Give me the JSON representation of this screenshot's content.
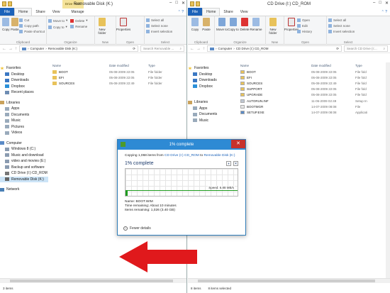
{
  "left": {
    "title": "Removable Disk (K:)",
    "context_tab": "Drive Tools",
    "tabs": [
      "File",
      "Home",
      "Share",
      "View",
      "Manage"
    ],
    "ribbon": {
      "clipboard": {
        "label": "Clipboard",
        "copy": "Copy",
        "paste": "Paste",
        "cut": "Cut",
        "copy_path": "Copy path",
        "paste_shortcut": "Paste shortcut"
      },
      "organize": {
        "label": "Organize",
        "move_to": "Move to",
        "copy_to": "Copy to",
        "delete": "Delete",
        "rename": "Rename"
      },
      "new": {
        "label": "New",
        "new_folder": "New folder"
      },
      "open": {
        "label": "Open",
        "properties": "Properties"
      },
      "select": {
        "label": "Select",
        "select_all": "Select all",
        "select_none": "Select none",
        "invert": "Invert selection"
      }
    },
    "address": [
      "Computer",
      "Removable Disk (K:)"
    ],
    "search_placeholder": "Search Removable ...",
    "columns": [
      "Name",
      "Date modified",
      "Type"
    ],
    "files": [
      {
        "name": "BOOT",
        "date": "05-08-2009 22:05",
        "type": "File folder"
      },
      {
        "name": "EFI",
        "date": "05-08-2009 22:05",
        "type": "File folder"
      },
      {
        "name": "SOURCES",
        "date": "05-08-2009 22:49",
        "type": "File folder"
      }
    ],
    "nav": {
      "favorites": "Favorites",
      "fav_items": [
        "Desktop",
        "Downloads",
        "Dropbox",
        "Recent places"
      ],
      "libraries": "Libraries",
      "lib_items": [
        "Apps",
        "Documents",
        "Music",
        "Pictures",
        "Videos"
      ],
      "computer": "Computer",
      "comp_items": [
        "Windows 8 (C:)",
        "Music and download",
        "video and movies (E:)",
        "Backup and software",
        "CD Drive (I:) CD_ROM",
        "Removable Disk (K:)"
      ],
      "network": "Network"
    },
    "status": "3 items"
  },
  "right": {
    "title": "CD Drive (I:) CD_ROM",
    "tabs": [
      "File",
      "Home",
      "Share",
      "View"
    ],
    "ribbon": {
      "clipboard": {
        "label": "Clipboard",
        "copy": "Copy",
        "paste": "Paste"
      },
      "organize": {
        "label": "Organize",
        "move_to": "Move to",
        "copy_to": "Copy to",
        "delete": "Delete",
        "rename": "Rename"
      },
      "new": {
        "label": "New",
        "new_folder": "New folder"
      },
      "open": {
        "label": "Open",
        "properties": "Properties",
        "open": "Open",
        "edit": "Edit",
        "history": "History"
      },
      "select": {
        "label": "Select",
        "select_all": "Select all",
        "select_none": "Select none",
        "invert": "Invert selection"
      }
    },
    "address": [
      "Computer",
      "CD Drive (I:) CD_ROM"
    ],
    "search_placeholder": "Search CD Drive (I:...",
    "columns": [
      "Name",
      "Date modified",
      "Type"
    ],
    "files": [
      {
        "name": "BOOT",
        "date": "05-08-2009 22:05",
        "type": "File fold",
        "kind": "folder"
      },
      {
        "name": "EFI",
        "date": "05-08-2009 22:05",
        "type": "File fold",
        "kind": "folder"
      },
      {
        "name": "SOURCES",
        "date": "05-08-2009 22:49",
        "type": "File fold",
        "kind": "folder"
      },
      {
        "name": "SUPPORT",
        "date": "05-08-2009 22:05",
        "type": "File fold",
        "kind": "folder"
      },
      {
        "name": "UPGRADE",
        "date": "05-08-2009 22:05",
        "type": "File fold",
        "kind": "folder"
      },
      {
        "name": "AUTORUN.INF",
        "date": "11-06-2009 02:49",
        "type": "Setup In",
        "kind": "setup"
      },
      {
        "name": "BOOTMGR",
        "date": "14-07-2009 08:08",
        "type": "File",
        "kind": "file"
      },
      {
        "name": "SETUP.EXE",
        "date": "14-07-2009 08:08",
        "type": "Applicati",
        "kind": "exe"
      }
    ],
    "nav": {
      "favorites": "Favorites",
      "fav_items": [
        "Desktop",
        "Downloads",
        "Dropbox"
      ],
      "libraries": "Libraries",
      "lib_items": [
        "Apps",
        "Documents",
        "Music"
      ]
    },
    "status": "8 items",
    "status_selected": "8 items selected"
  },
  "dialog": {
    "title": "1% complete",
    "copy_prefix": "Copying 1,068 items from ",
    "source": "CD Drive (I:) CD_ROM",
    "to": " to ",
    "dest": "Removable Disk (K:)",
    "percent": "1% complete",
    "pause_icon": "pause-icon",
    "speed": "Speed: 6.88 MB/s",
    "name": "Name: BOOT.WIM",
    "time_remaining": "Time remaining: About 10 minutes",
    "items_remaining": "Items remaining: 1,026 (3.40 GB)",
    "fewer_details": "Fewer details",
    "progress_fraction": 0.01
  },
  "colors": {
    "accent": "#1c62b9",
    "title_bar": "#2e8ad4",
    "progress": "#1f9c1f",
    "arrow": "#e0191c",
    "close": "#c7312b",
    "folder": "#e8c25a"
  }
}
